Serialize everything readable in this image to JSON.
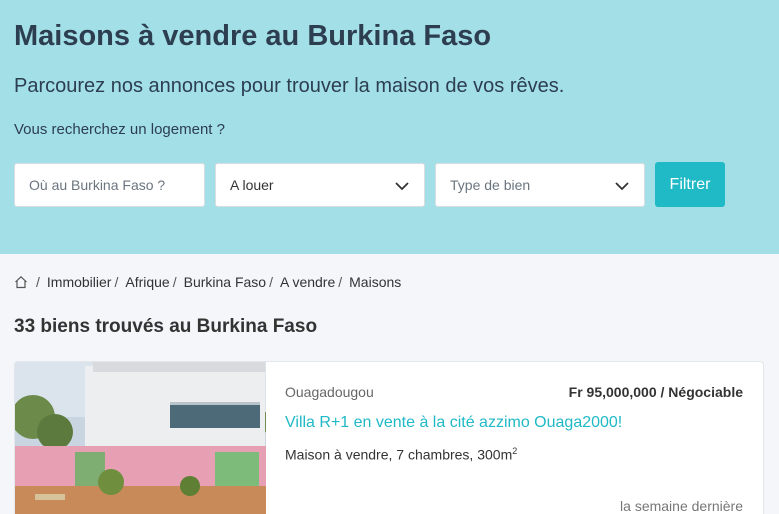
{
  "hero": {
    "title": "Maisons à vendre au Burkina Faso",
    "subtitle": "Parcourez nos annonces pour trouver la maison de vos rêves.",
    "question": "Vous recherchez un logement ?"
  },
  "search": {
    "location_placeholder": "Où au Burkina Faso ?",
    "transaction_value": "A louer",
    "property_type_placeholder": "Type de bien",
    "filter_label": "Filtrer"
  },
  "breadcrumb": {
    "items": [
      "Immobilier",
      "Afrique",
      "Burkina Faso",
      "A vendre",
      "Maisons"
    ]
  },
  "results": {
    "count_text": "33 biens trouvés au Burkina Faso"
  },
  "listing": {
    "city": "Ouagadougou",
    "price": "Fr 95,000,000 / Négociable",
    "title": "Villa R+1 en vente à la cité azzimo Ouaga2000!",
    "description": "Maison à vendre, 7 chambres, 300m",
    "area_exponent": "2",
    "date": "la semaine dernière"
  },
  "colors": {
    "hero_bg": "#a3dfe6",
    "accent": "#20b9c6",
    "title_text": "#2c3e50"
  },
  "icons": [
    "home-icon",
    "chevron-down-icon"
  ]
}
